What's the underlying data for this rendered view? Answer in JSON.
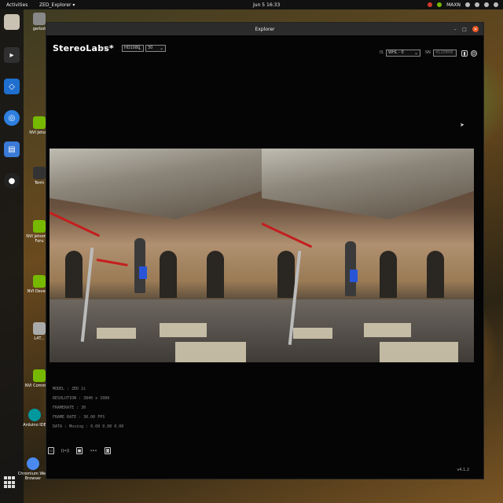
{
  "topbar": {
    "activities": "Activities",
    "app_name": "ZED_Explorer ▾",
    "clock": "Jun 5  16:33",
    "tray_text": "MAXN",
    "tray_icons": [
      "power-icon",
      "battery-icon",
      "help-icon",
      "volume-icon",
      "system-menu-icon"
    ]
  },
  "dock": {
    "icons": [
      "files-icon",
      "terminal-icon",
      "vscode-icon",
      "chromium-icon",
      "calendar-icon",
      "obs-icon"
    ]
  },
  "desktop": {
    "items": [
      {
        "label": "gerbot"
      },
      {
        "label": "NVI Jetson"
      },
      {
        "label": "Term"
      },
      {
        "label": "NVI Jetson Sd Foru"
      },
      {
        "label": "NVI Develop"
      },
      {
        "label": "L4T..."
      },
      {
        "label": "NVI Communit"
      },
      {
        "label": "Arduino IDE"
      },
      {
        "label": "Chromium Web Browser"
      }
    ]
  },
  "window": {
    "title": "Explorer",
    "brand": "StereoLabs*",
    "live": "LIVE",
    "resolution": "HD1080",
    "fps": "30",
    "ctrl_label": "IS",
    "white_balance": "WHL - 0",
    "sn_label": "SN",
    "serial_value": "4120808",
    "version": "v4.1.2",
    "info_lines": [
      "MODEL : ZED 2i",
      "RESOLUTION : 3840 x 1080",
      "FRAMERATE : 30",
      "FRAME RATE : 30.00 FPS",
      "DATA : Moving : 0.00 0.00 0.00"
    ],
    "tools": [
      "folder-icon",
      "wireless-icon",
      "record-icon",
      "more-icon",
      "camera-icon"
    ]
  },
  "colors": {
    "accent": "#e95420",
    "nvidia_green": "#76b900",
    "rope_red": "#c41e1e"
  }
}
